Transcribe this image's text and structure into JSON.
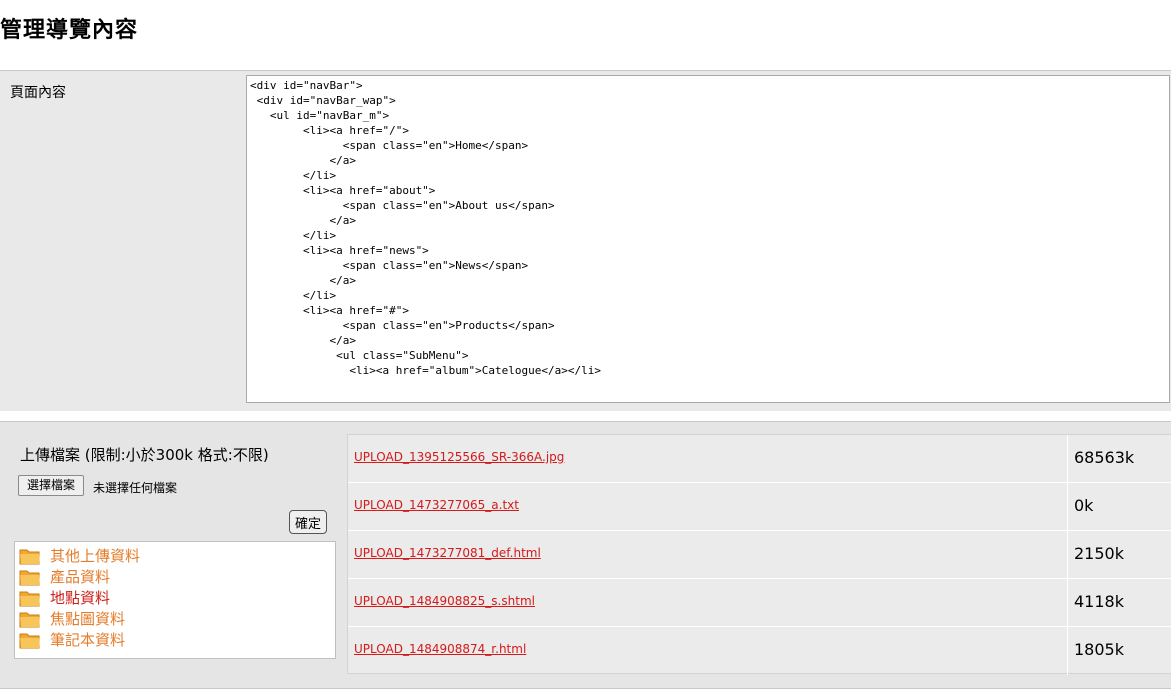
{
  "page": {
    "title": "管理導覽內容"
  },
  "form": {
    "content_label": "頁面內容",
    "content_code": "<div id=\"navBar\">\n <div id=\"navBar_wap\">\n   <ul id=\"navBar_m\">\n        <li><a href=\"/\">\n              <span class=\"en\">Home</span>\n            </a>\n        </li>\n        <li><a href=\"about\">\n              <span class=\"en\">About us</span>\n            </a>\n        </li>\n        <li><a href=\"news\">\n              <span class=\"en\">News</span>\n            </a>\n        </li>\n        <li><a href=\"#\">\n              <span class=\"en\">Products</span>\n            </a>\n             <ul class=\"SubMenu\">\n               <li><a href=\"album\">Catelogue</a></li>"
  },
  "upload": {
    "title": "上傳檔案 (限制:小於300k 格式:不限)",
    "choose_button": "選擇檔案",
    "no_file_text": "未選擇任何檔案",
    "confirm_button": "確定",
    "folders": [
      {
        "label": "其他上傳資料",
        "icon": "folder-icon"
      },
      {
        "label": "產品資料",
        "icon": "folder-icon"
      },
      {
        "label": "地點資料",
        "icon": "folder-icon",
        "active": true
      },
      {
        "label": "焦點圖資料",
        "icon": "folder-icon"
      },
      {
        "label": "筆記本資料",
        "icon": "folder-icon"
      }
    ],
    "files": [
      {
        "name": "UPLOAD_1395125566_SR-366A.jpg",
        "size": "68563k"
      },
      {
        "name": "UPLOAD_1473277065_a.txt",
        "size": "0k"
      },
      {
        "name": "UPLOAD_1473277081_def.html",
        "size": "2150k"
      },
      {
        "name": "UPLOAD_1484908825_s.shtml",
        "size": "4118k"
      },
      {
        "name": "UPLOAD_1484908874_r.html",
        "size": "1805k"
      }
    ]
  },
  "colors": {
    "link": "#d41a1a",
    "folder_label": "#e47d2b",
    "folder_label_active": "#d0201a"
  }
}
